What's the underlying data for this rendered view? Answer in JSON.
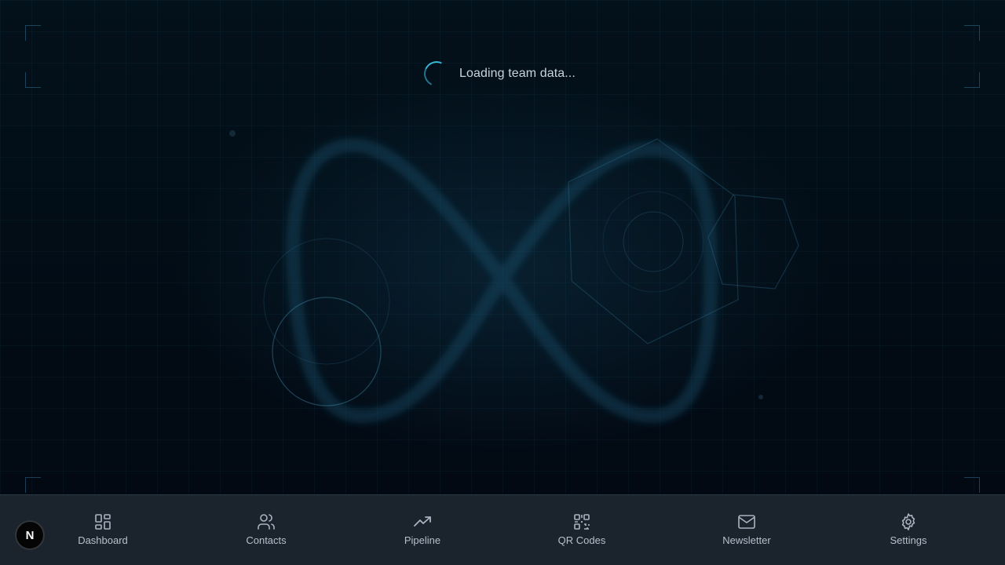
{
  "loading": {
    "text": "Loading team data..."
  },
  "nav": {
    "items": [
      {
        "label": "Dashboard",
        "icon": "dashboard-grid-icon"
      },
      {
        "label": "Contacts",
        "icon": "contacts-users-icon"
      },
      {
        "label": "Pipeline",
        "icon": "trending-up-icon"
      },
      {
        "label": "QR Codes",
        "icon": "qr-code-icon"
      },
      {
        "label": "Newsletter",
        "icon": "mail-icon"
      },
      {
        "label": "Settings",
        "icon": "gear-icon"
      }
    ]
  },
  "fab": {
    "letter": "N"
  },
  "colors": {
    "accent": "#37b7d6",
    "navbar": "#1b232d",
    "background": "#03080f"
  }
}
